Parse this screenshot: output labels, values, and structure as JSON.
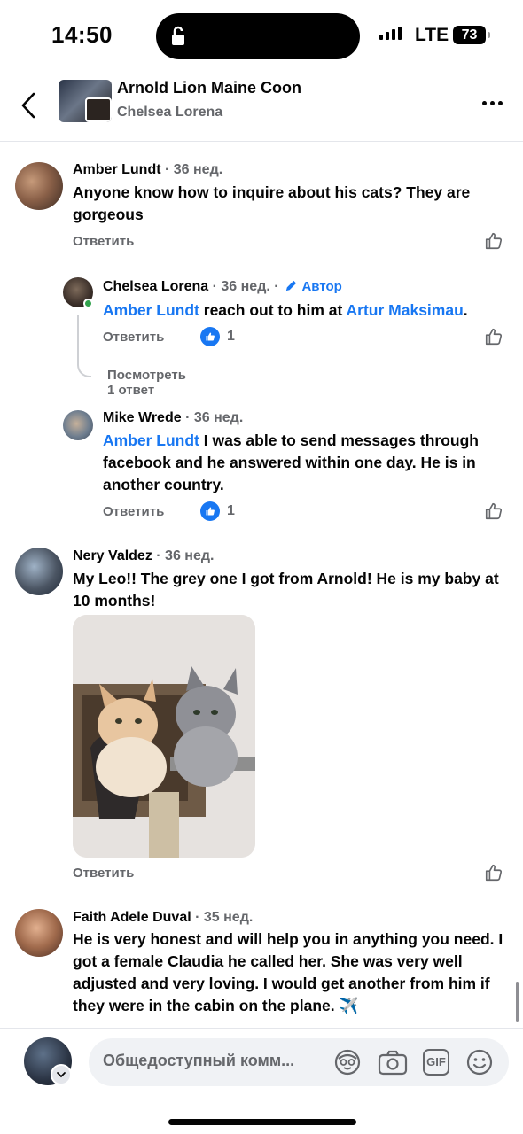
{
  "status_bar": {
    "time": "14:50",
    "network": "LTE",
    "battery": "73"
  },
  "header": {
    "group_title": "Arnold Lion Maine Coon",
    "author_name": "Chelsea Lorena",
    "back_icon": "chevron-left-icon",
    "more_icon": "more-horizontal-icon"
  },
  "comments": [
    {
      "name": "Amber Lundt",
      "time": "· 36 нед.",
      "text": "Anyone know how to inquire about his cats? They are gorgeous",
      "reply_label": "Ответить"
    },
    {
      "name": "Chelsea Lorena",
      "time": "· 36 нед. ·",
      "author_badge": "Автор",
      "mention": "Amber Lundt",
      "text_mid": " reach out to him at ",
      "mention2": "Artur Maksimau",
      "text_end": ".",
      "reply_label": "Ответить",
      "like_count": "1",
      "view_replies": "Посмотреть 1 ответ"
    },
    {
      "name": "Mike Wrede",
      "time": "· 36 нед.",
      "mention": "Amber Lundt",
      "text": " I was able to send messages through facebook and he answered within one day. He is in another country.",
      "reply_label": "Ответить",
      "like_count": "1"
    },
    {
      "name": "Nery Valdez",
      "time": "· 36 нед.",
      "text": "My Leo!! The grey one I got from Arnold!  He is my baby at 10 months!",
      "reply_label": "Ответить"
    },
    {
      "name": "Faith Adele Duval",
      "time": "· 35 нед.",
      "text": "He is very honest and will help you in anything you need. I got a female Claudia he called her.  She was very well adjusted and very loving.  I would get another from him if they were in the cabin on the plane. ✈️"
    }
  ],
  "composer": {
    "placeholder": "Общедоступный комм...",
    "tools": [
      "avatar-sticker-icon",
      "camera-icon",
      "gif-icon",
      "emoji-icon"
    ],
    "gif_label": "GIF"
  },
  "colors": {
    "accent": "#1877f2",
    "secondary_text": "#65676b",
    "primary_text": "#050505"
  }
}
